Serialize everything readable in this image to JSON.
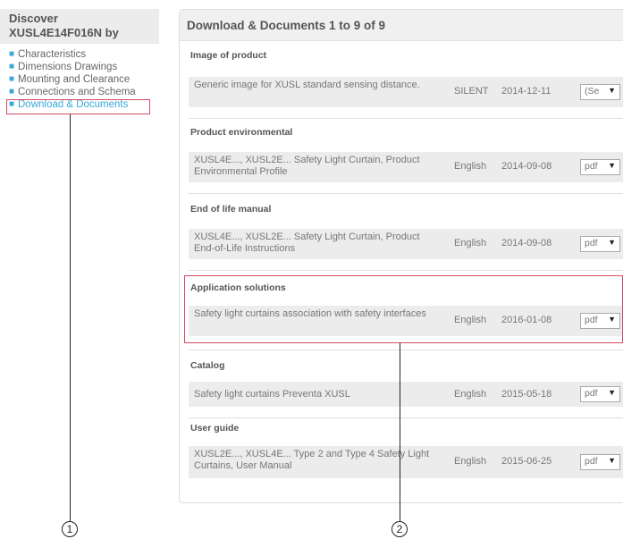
{
  "sidebar": {
    "title": "Discover XUSL4E14F016N by",
    "items": [
      {
        "label": "Characteristics"
      },
      {
        "label": "Dimensions Drawings"
      },
      {
        "label": "Mounting and Clearance"
      },
      {
        "label": "Connections and Schema"
      },
      {
        "label": "Download & Documents"
      }
    ],
    "active_index": 4
  },
  "panel": {
    "header": "Download & Documents 1 to 9 of 9",
    "sections": [
      {
        "title": "Image of product",
        "doc": {
          "description": "Generic image for XUSL standard sensing distance.",
          "language": "SILENT",
          "date": "2014-12-11",
          "format": "(Se"
        }
      },
      {
        "title": "Product environmental",
        "doc": {
          "description": "XUSL4E..., XUSL2E... Safety Light Curtain, Product Environmental Profile",
          "language": "English",
          "date": "2014-09-08",
          "format": "pdf"
        }
      },
      {
        "title": "End of life manual",
        "doc": {
          "description": "XUSL4E..., XUSL2E... Safety Light Curtain, Product End-of-Life Instructions",
          "language": "English",
          "date": "2014-09-08",
          "format": "pdf"
        }
      },
      {
        "title": "Application solutions",
        "doc": {
          "description": "Safety light curtains association with safety interfaces",
          "language": "English",
          "date": "2016-01-08",
          "format": "pdf"
        }
      },
      {
        "title": "Catalog",
        "doc": {
          "description": "Safety light curtains Preventa XUSL",
          "language": "English",
          "date": "2015-05-18",
          "format": "pdf"
        }
      },
      {
        "title": "User guide",
        "doc": {
          "description": "XUSL2E..., XUSL4E... Type 2 and Type 4 Safety Light Curtains, User Manual",
          "language": "English",
          "date": "2015-06-25",
          "format": "pdf"
        }
      }
    ]
  },
  "callouts": [
    "1",
    "2"
  ],
  "colors": {
    "accent": "#3aa7d8",
    "highlight": "#d54a67",
    "header_bg": "#f0f0f0",
    "row_bg": "#ececec"
  },
  "icons": {
    "bullet": "bullet-icon",
    "dropdown": "chevron-down-icon"
  }
}
